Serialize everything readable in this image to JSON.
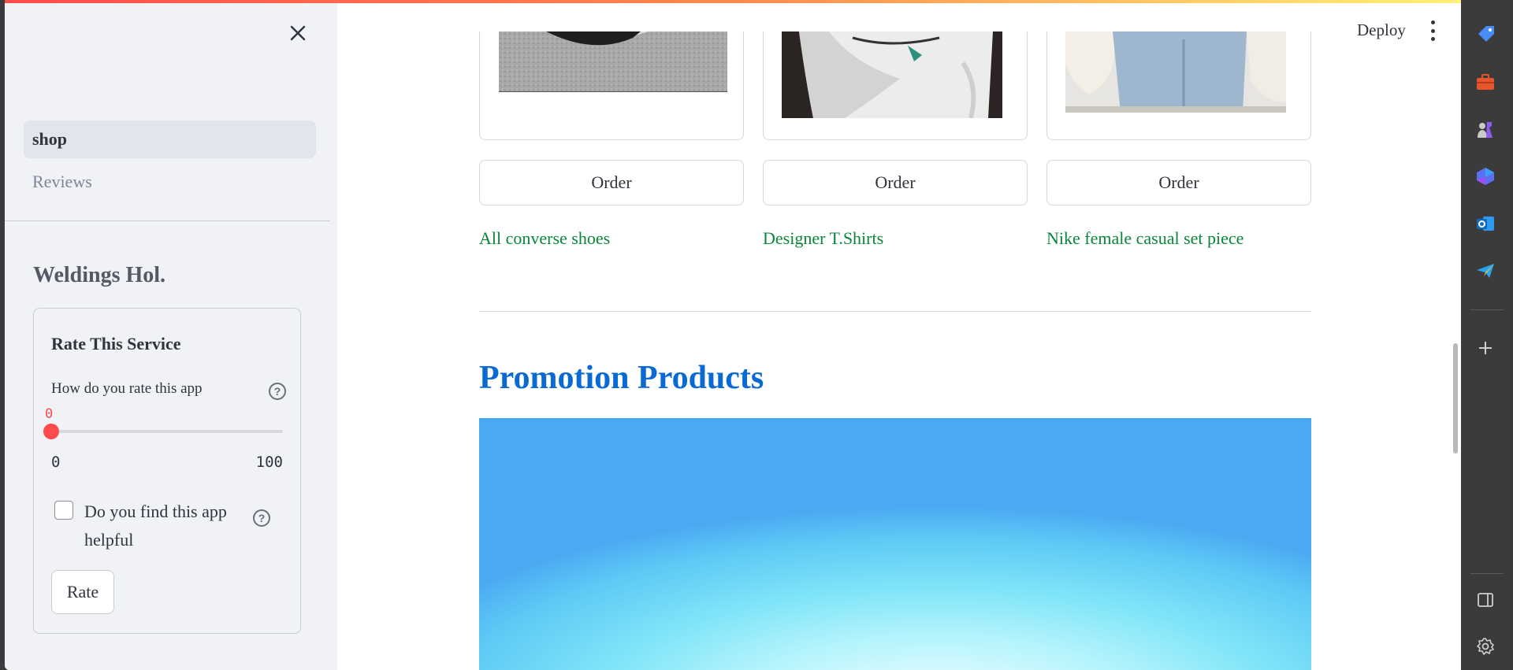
{
  "header": {
    "deploy_label": "Deploy"
  },
  "sidebar": {
    "nav": [
      {
        "label": "shop",
        "active": true
      },
      {
        "label": "Reviews",
        "active": false
      }
    ],
    "title": "Weldings Hol.",
    "rate_card": {
      "title": "Rate This Service",
      "slider": {
        "label": "How do you rate this app",
        "value": "0",
        "min": "0",
        "max": "100",
        "fraction": 0
      },
      "checkbox_label": "Do you find this app helpful",
      "checked": false,
      "button_label": "Rate"
    }
  },
  "main": {
    "products": [
      {
        "order_label": "Order",
        "name": "All converse shoes"
      },
      {
        "order_label": "Order",
        "name": "Designer T.Shirts"
      },
      {
        "order_label": "Order",
        "name": "Nike female casual set piece"
      }
    ],
    "section_title": "Promotion Products"
  },
  "colors": {
    "accent": "#ff4b4b",
    "link_green": "#09863a",
    "heading_blue": "#0a6ad4",
    "sidebar_bg": "#f0f2f6"
  },
  "rail_icons": [
    "tag-icon",
    "briefcase-icon",
    "chess-icon",
    "copilot-icon",
    "outlook-icon",
    "send-icon",
    "plus-icon",
    "split-screen-icon",
    "settings-icon"
  ]
}
